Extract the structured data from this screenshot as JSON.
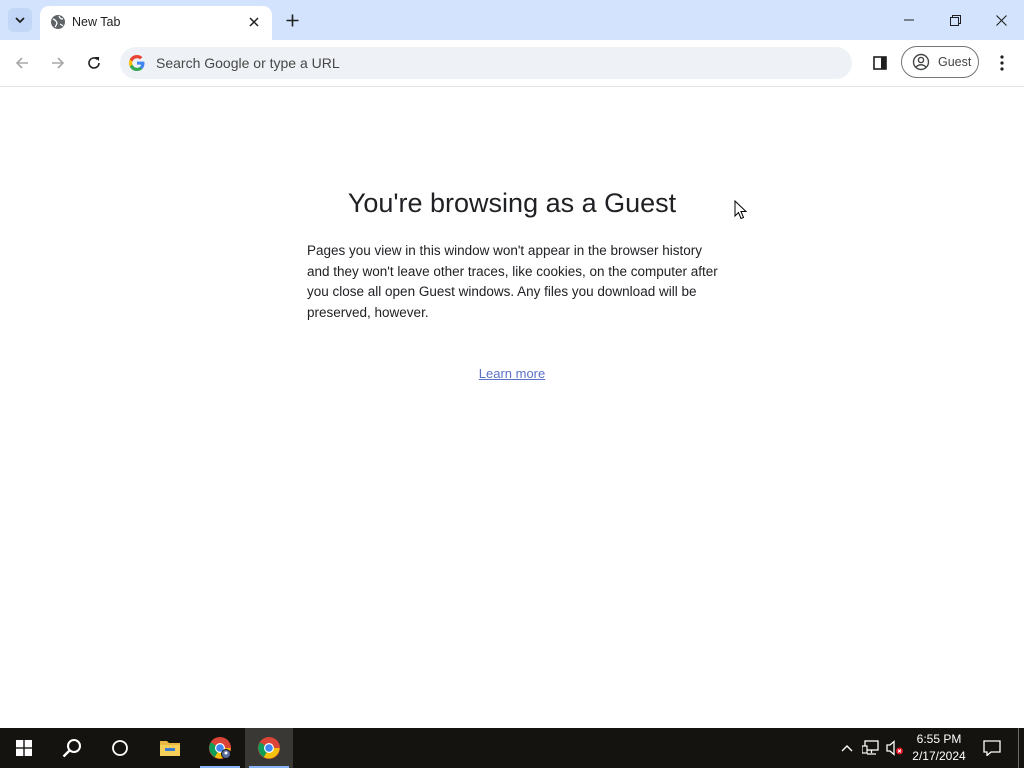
{
  "browser": {
    "tab": {
      "title": "New Tab"
    },
    "omnibox": {
      "placeholder": "Search Google or type a URL",
      "value": ""
    },
    "profile": {
      "label": "Guest"
    }
  },
  "page": {
    "heading": "You're browsing as a Guest",
    "description": "Pages you view in this window won't appear in the browser history and they won't leave other traces, like cookies, on the computer after you close all open Guest windows. Any files you download will be preserved, however.",
    "learn_more": "Learn more"
  },
  "taskbar": {
    "time": "6:55 PM",
    "date": "2/17/2024"
  },
  "colors": {
    "tabstrip": "#d3e3fd",
    "omnibox": "#eef1f6",
    "link": "#5a73c9",
    "taskbar": "#15130f"
  }
}
